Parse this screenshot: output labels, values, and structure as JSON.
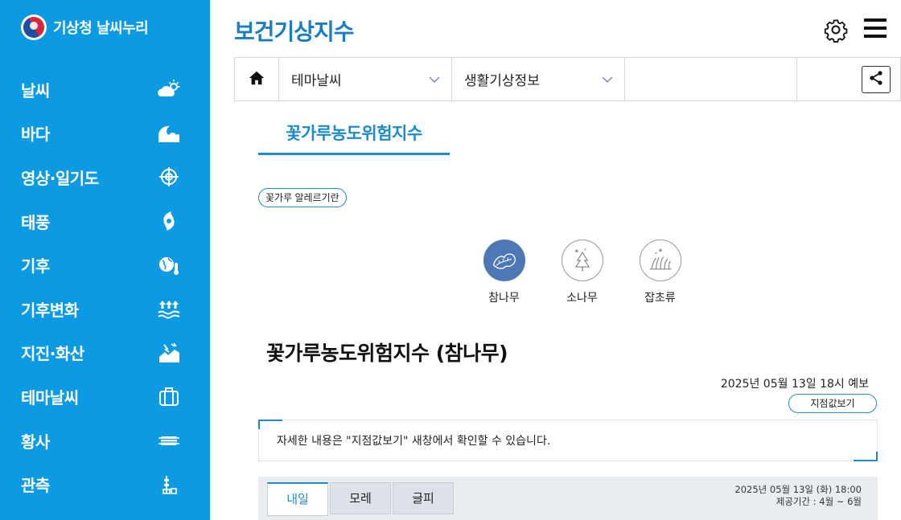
{
  "brand": {
    "name": "기상청 날씨누리",
    "logo_icon": "korea-government-emblem-icon"
  },
  "sidebar": {
    "bg_color": "#0c9ae3",
    "items": [
      {
        "label": "날씨",
        "icon": "cloud-sun-icon"
      },
      {
        "label": "바다",
        "icon": "wave-icon"
      },
      {
        "label": "영상·일기도",
        "icon": "satellite-target-icon"
      },
      {
        "label": "태풍",
        "icon": "typhoon-icon"
      },
      {
        "label": "기후",
        "icon": "globe-thermometer-icon"
      },
      {
        "label": "기후변화",
        "icon": "rising-water-icon"
      },
      {
        "label": "지진·화산",
        "icon": "earthquake-icon"
      },
      {
        "label": "테마날씨",
        "icon": "suitcase-icon"
      },
      {
        "label": "황사",
        "icon": "mask-icon"
      },
      {
        "label": "관측",
        "icon": "observation-tower-icon"
      }
    ]
  },
  "header": {
    "title": "보건기상지수",
    "settings_icon": "gear-icon",
    "menu_icon": "hamburger-icon"
  },
  "breadcrumb": {
    "home_icon": "home-icon",
    "level1": "테마날씨",
    "level2": "생활기상정보",
    "share_icon": "share-icon"
  },
  "main_tab": {
    "label": "꽃가루농도위험지수"
  },
  "allergy_button": {
    "label": "꽃가루 알레르기란"
  },
  "pollen_types": [
    {
      "label": "참나무",
      "icon": "oak-leaf-icon",
      "active": true
    },
    {
      "label": "소나무",
      "icon": "pine-tree-icon",
      "active": false
    },
    {
      "label": "잡초류",
      "icon": "weed-grass-icon",
      "active": false
    }
  ],
  "section": {
    "title": "꽃가루농도위험지수 (참나무)",
    "forecast_time": "2025년 05월 13일 18시 예보",
    "point_button": "지점값보기",
    "info_text": "자세한 내용은 \"지점값보기\" 새창에서 확인할 수 있습니다."
  },
  "day_tabs": {
    "tabs": [
      {
        "label": "내일",
        "active": true
      },
      {
        "label": "모레",
        "active": false
      },
      {
        "label": "글피",
        "active": false
      }
    ],
    "issued": "2025년 05월 13일 (화) 18:00",
    "period": "제공기간 : 4월 ~ 6월"
  },
  "colors": {
    "accent": "#1b8bcc",
    "title_blue": "#1b7cc0",
    "active_pollen": "#4e78b5"
  }
}
